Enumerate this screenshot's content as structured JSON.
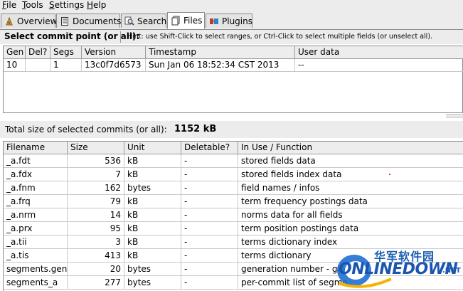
{
  "menu": [
    {
      "label": "File",
      "key": "F",
      "rest": "ile"
    },
    {
      "label": "Tools",
      "key": "T",
      "rest": "ools"
    },
    {
      "label": "Settings",
      "key": "S",
      "rest": "ettings"
    },
    {
      "label": "Help",
      "key": "H",
      "rest": "elp"
    }
  ],
  "tabs": [
    {
      "label": "Overview",
      "icon": "overview-icon"
    },
    {
      "label": "Documents",
      "icon": "document-icon"
    },
    {
      "label": "Search",
      "icon": "search-icon"
    },
    {
      "label": "Files",
      "icon": "files-icon",
      "active": true
    },
    {
      "label": "Plugins",
      "icon": "plugins-icon"
    }
  ],
  "commit": {
    "label": "Select commit point (or all):",
    "hint": "Hint: use Shift-Click to select ranges, or Ctrl-Click to select multiple fields (or unselect all).",
    "columns": [
      "Gen",
      "Del?",
      "Segs",
      "Version",
      "Timestamp",
      "User data"
    ],
    "rows": [
      [
        "10",
        "",
        "1",
        "13c0f7d6573",
        "Sun Jan 06 18:52:34 CST 2013",
        "--"
      ]
    ]
  },
  "total": {
    "label": "Total size of selected commits (or all):",
    "value": "1152 kB"
  },
  "files": {
    "columns": [
      "Filename",
      "Size",
      "Unit",
      "Deletable?",
      "In Use / Function"
    ],
    "rows": [
      [
        "_a.fdt",
        "536",
        "kB",
        "-",
        "stored fields data"
      ],
      [
        "_a.fdx",
        "7",
        "kB",
        "-",
        "stored fields index data"
      ],
      [
        "_a.fnm",
        "162",
        "bytes",
        "-",
        "field names / infos"
      ],
      [
        "_a.frq",
        "79",
        "kB",
        "-",
        "term frequency postings data"
      ],
      [
        "_a.nrm",
        "14",
        "kB",
        "-",
        "norms data for all fields"
      ],
      [
        "_a.prx",
        "95",
        "kB",
        "-",
        "term position postings data"
      ],
      [
        "_a.tii",
        "3",
        "kB",
        "-",
        "terms dictionary index"
      ],
      [
        "_a.tis",
        "413",
        "kB",
        "-",
        "terms dictionary"
      ],
      [
        "segments.gen",
        "20",
        "bytes",
        "-",
        "generation number - glo"
      ],
      [
        "segments_a",
        "277",
        "bytes",
        "-",
        "per-commit list of segme"
      ]
    ]
  },
  "watermark": {
    "cn": "华军软件园",
    "en": "ONLINEDOWN",
    ".net": ".NET"
  },
  "colors": {
    "chrome": "#ececec",
    "border": "#8c8c8c",
    "brand": "#1a56b0"
  }
}
